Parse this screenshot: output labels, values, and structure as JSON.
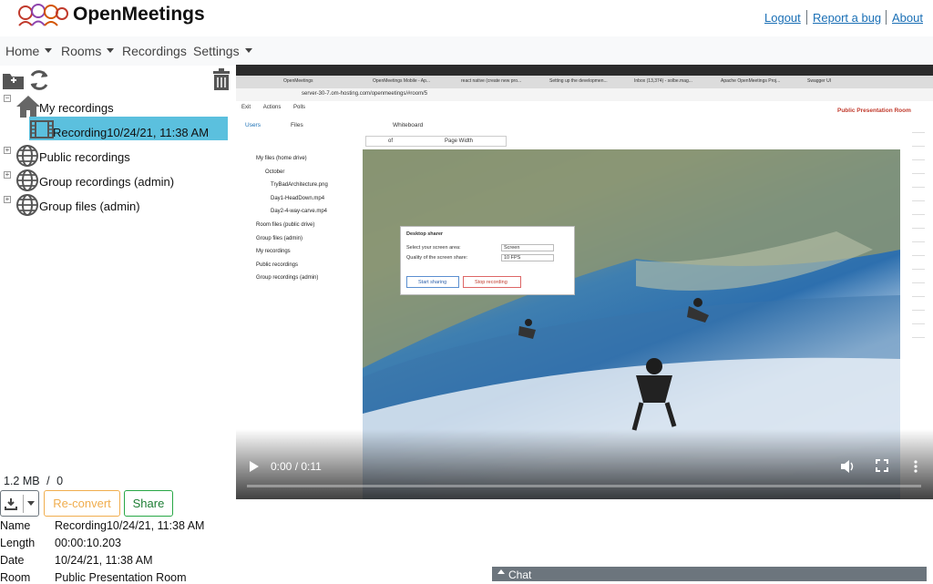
{
  "header": {
    "app_title": "OpenMeetings",
    "links": {
      "logout": "Logout",
      "report_bug": "Report a bug",
      "about": "About"
    }
  },
  "nav": {
    "home": "Home",
    "rooms": "Rooms",
    "recordings": "Recordings",
    "settings": "Settings"
  },
  "tree": {
    "my_recordings": "My recordings",
    "selected_recording": "Recording10/24/21, 11:38 AM",
    "public_recordings": "Public recordings",
    "group_recordings": "Group recordings (admin)",
    "group_files": "Group files (admin)"
  },
  "size_info": {
    "size": "1.2 MB",
    "divider": "/",
    "count": "0"
  },
  "buttons": {
    "reconvert": "Re-convert",
    "share": "Share"
  },
  "details": [
    {
      "key": "Name",
      "value": "Recording10/24/21, 11:38 AM"
    },
    {
      "key": "Length",
      "value": "00:00:10.203"
    },
    {
      "key": "Date",
      "value": "10/24/21, 11:38 AM"
    },
    {
      "key": "Room",
      "value": "Public Presentation Room"
    }
  ],
  "video": {
    "time": "0:00 / 0:11",
    "progress": 0.0,
    "inner": {
      "browser_tabs": [
        "OpenMeetings",
        "OpenMeetings Mobile - Ap...",
        "react native (create new pro...",
        "Setting up the developmen...",
        "Inbox (13,374) - solbe.mag...",
        "Apache OpenMeetings Proj...",
        "Swagger UI"
      ],
      "url": "server-30-7.om-hosting.com/openmeetings/#room/5",
      "exit": "Exit",
      "actions": "Actions",
      "polls": "Polls",
      "room_title": "Public Presentation Room",
      "users_tab": "Users",
      "files_tab": "Files",
      "whiteboard_tab": "Whiteboard",
      "page_width": "Page Width",
      "page_of": "of",
      "files": [
        "My files (home drive)",
        "October",
        "TryBadArchitecture.png",
        "Day1-HeadDown.mp4",
        "Day2-4-way-carve.mp4",
        "Room files (public drive)",
        "Group files (admin)",
        "My recordings",
        "Public recordings",
        "Group recordings (admin)"
      ],
      "dialog": {
        "title": "Desktop sharer",
        "area_label": "Select your screen area:",
        "area_value": "Screen",
        "quality_label": "Quality of the screen share:",
        "quality_value": "10 FPS",
        "start": "Start sharing",
        "stop": "Stop recording"
      }
    }
  },
  "chat": {
    "label": "Chat"
  },
  "colors": {
    "accent": "#5bc0de",
    "warning": "#f0ad4e",
    "success": "#28a745",
    "link": "#1a6fb5"
  }
}
